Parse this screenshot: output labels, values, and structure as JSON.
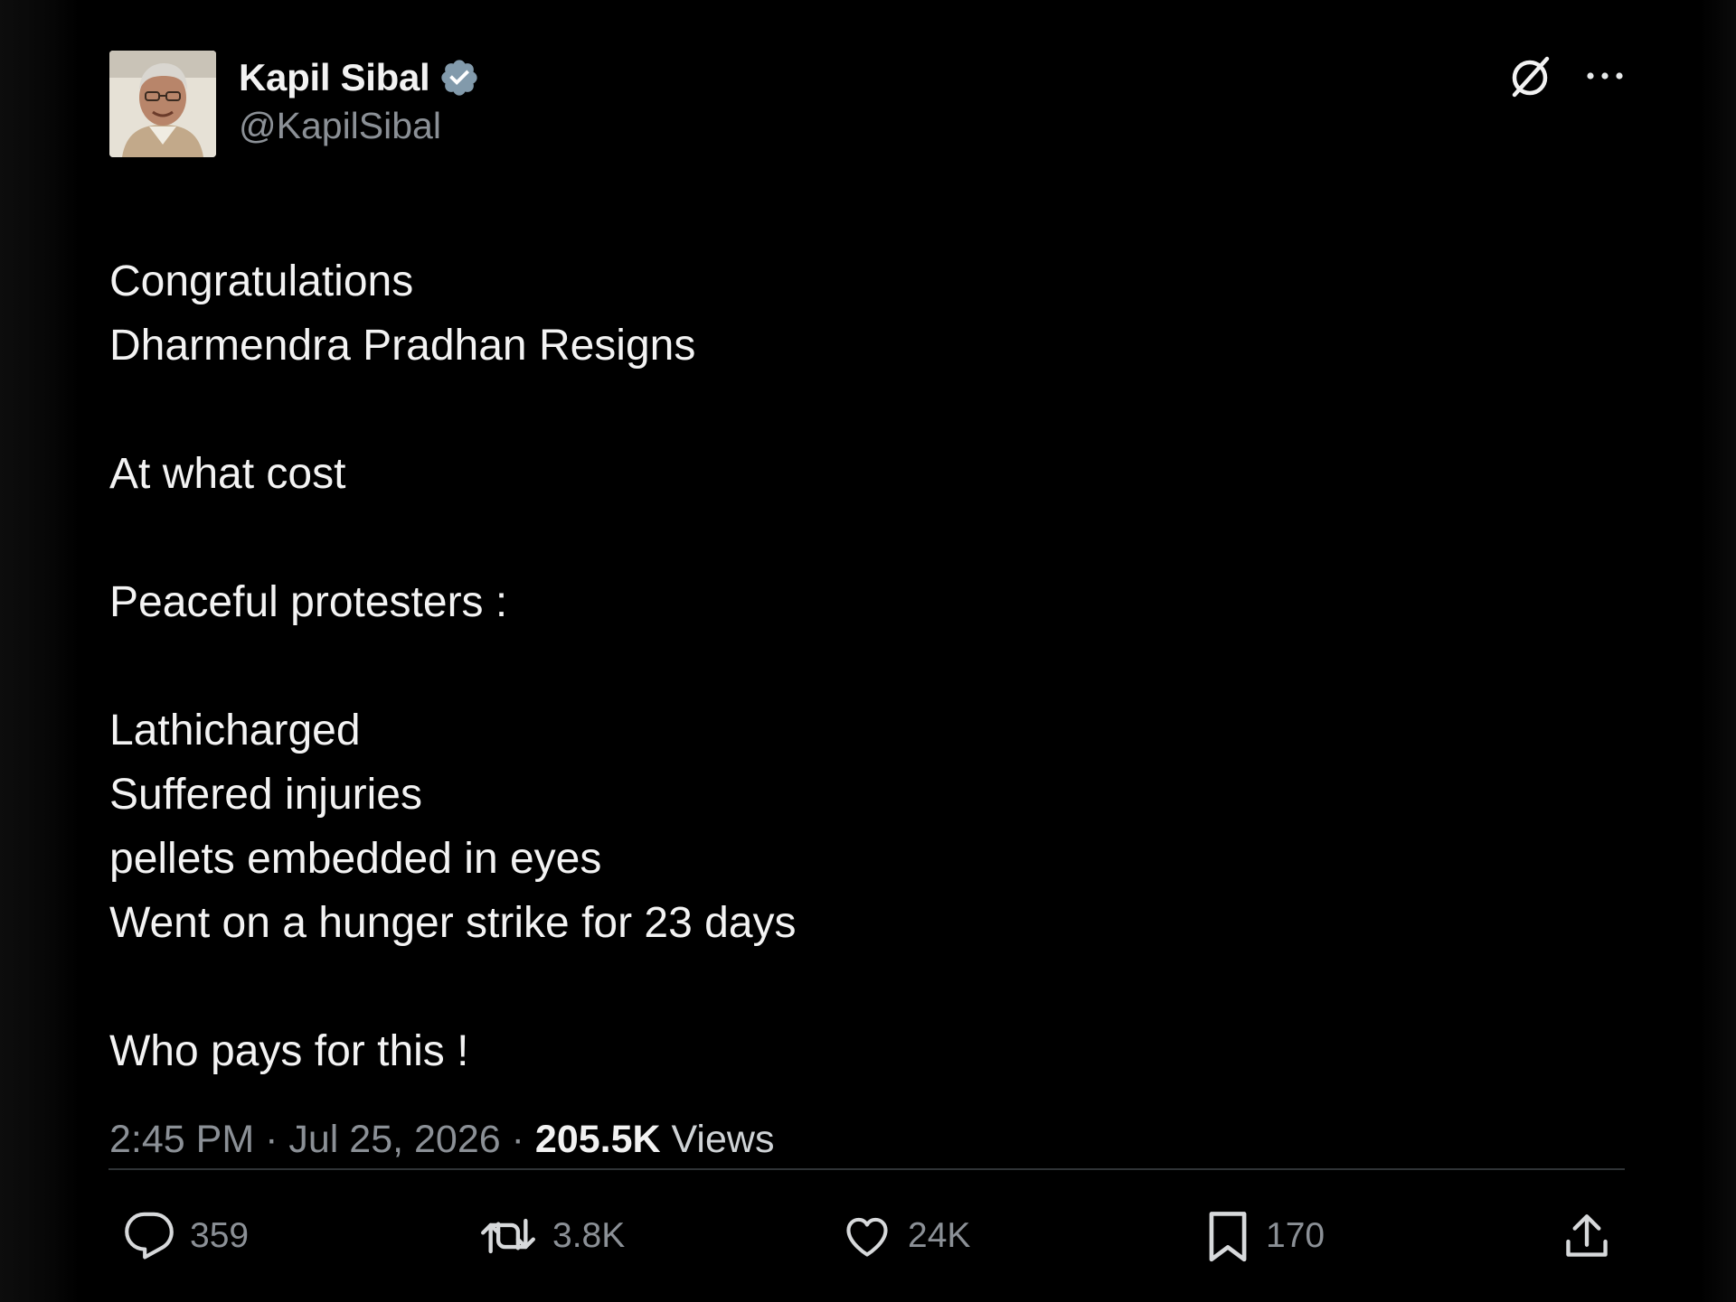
{
  "author": {
    "display_name": "Kapil Sibal",
    "handle": "@KapilSibal",
    "verified_icon": "verified-badge-icon",
    "verified_color": "#829aab"
  },
  "top_actions": {
    "grok_icon": "grok-icon",
    "more_icon": "more-icon"
  },
  "tweet": {
    "lines": [
      "Congratulations",
      "Dharmendra Pradhan Resigns",
      "",
      "At what cost",
      "",
      "Peaceful protesters :",
      "",
      "Lathicharged",
      "Suffered injuries",
      "pellets embedded in eyes",
      "Went on a hunger strike for 23 days",
      "",
      "Who pays for this !"
    ]
  },
  "meta": {
    "time": "2:45 PM",
    "separator": "·",
    "date": "Jul 25, 2026",
    "views_count": "205.5K",
    "views_label": "Views"
  },
  "actions": {
    "replies": {
      "icon": "reply-icon",
      "count": "359"
    },
    "reposts": {
      "icon": "repost-icon",
      "count": "3.8K"
    },
    "likes": {
      "icon": "heart-icon",
      "count": "24K"
    },
    "bookmarks": {
      "icon": "bookmark-icon",
      "count": "170"
    },
    "share": {
      "icon": "share-icon"
    }
  },
  "colors": {
    "background": "#000000",
    "text_primary": "#f3f3f3",
    "text_secondary": "#8b9096",
    "divider": "#2f3336"
  }
}
